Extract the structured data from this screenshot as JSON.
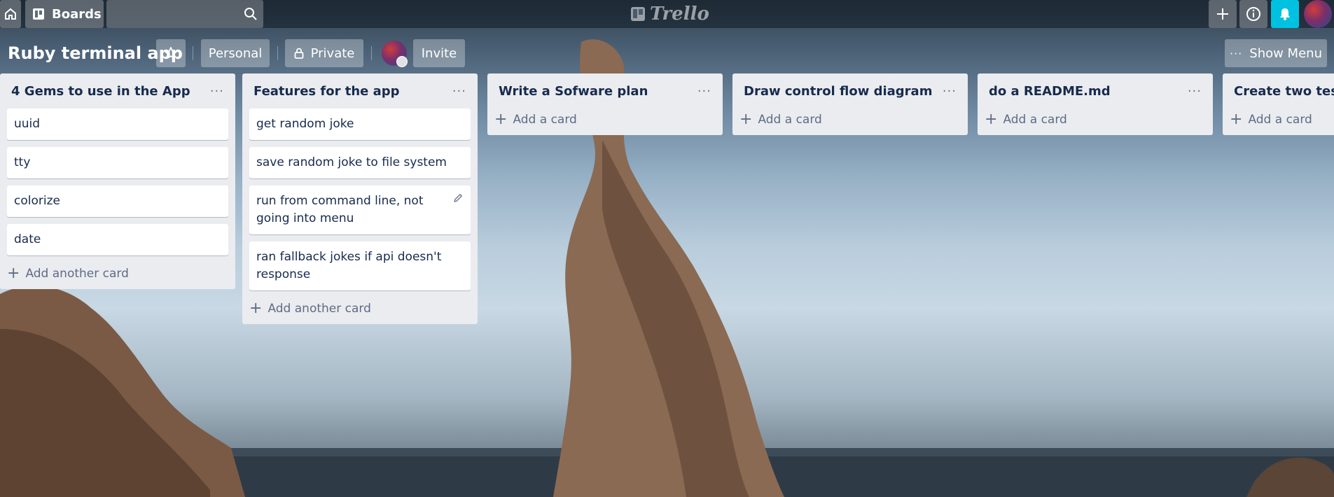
{
  "header": {
    "boards_label": "Boards",
    "search_placeholder": "",
    "logo_text": "Trello"
  },
  "board": {
    "title": "Ruby terminal app",
    "team_label": "Personal",
    "visibility_label": "Private",
    "invite_label": "Invite",
    "show_menu_label": "Show Menu"
  },
  "lists": [
    {
      "title": "4 Gems to use in the App",
      "cards": [
        "uuid",
        "tty",
        "colorize",
        "date"
      ],
      "add_label": "Add another card"
    },
    {
      "title": "Features for the app",
      "cards": [
        "get random joke",
        "save random joke to file system",
        "run from command line, not going into menu",
        "ran fallback jokes if api doesn't response"
      ],
      "add_label": "Add another card"
    },
    {
      "title": "Write a Sofware plan",
      "cards": [],
      "add_label": "Add a card"
    },
    {
      "title": "Draw control flow diagram",
      "cards": [],
      "add_label": "Add a card"
    },
    {
      "title": "do a README.md",
      "cards": [],
      "add_label": "Add a card"
    },
    {
      "title": "Create two test c",
      "cards": [],
      "add_label": "Add a card"
    }
  ],
  "icons": {
    "home": "home-icon",
    "boards": "boards-icon",
    "search": "search-icon",
    "add": "plus-icon",
    "info": "info-icon",
    "notifications": "bell-icon",
    "star": "star-icon",
    "lock": "lock-icon",
    "menu": "ellipsis-icon",
    "edit": "pencil-icon"
  },
  "colors": {
    "notification_accent": "#00c2e0",
    "list_background": "#ebecf0",
    "card_text": "#172b4d"
  }
}
